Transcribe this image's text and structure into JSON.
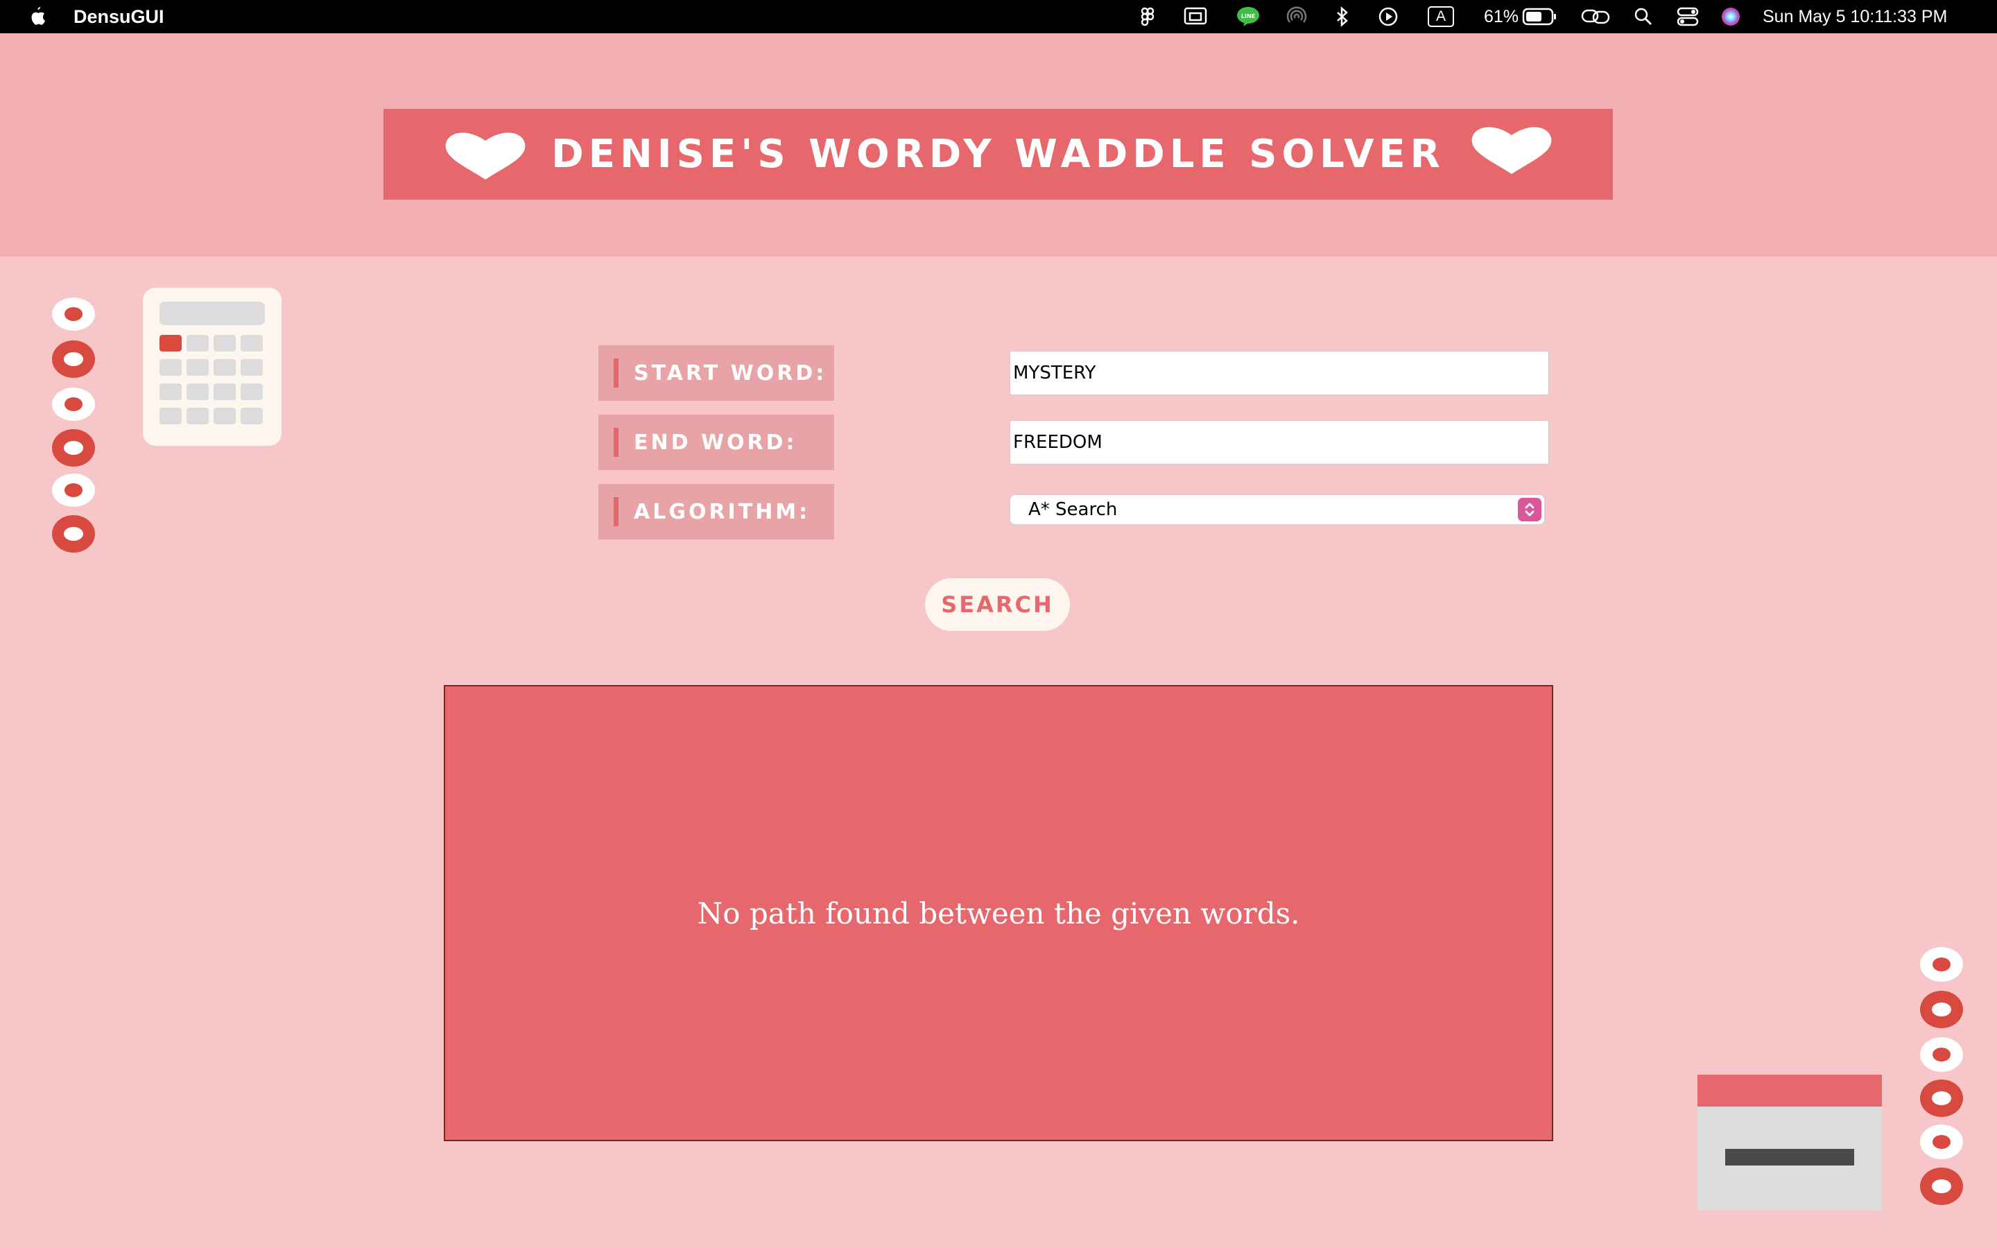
{
  "menubar": {
    "app_name": "DensuGUI",
    "battery": "61%",
    "datetime": "Sun May 5  10:11:33 PM",
    "icons": [
      "apple-icon",
      "figma-icon",
      "screen-mirror-icon",
      "line-icon",
      "airdrop-icon",
      "bluetooth-icon",
      "play-icon",
      "keyboard-input-icon",
      "battery-icon",
      "link-icon",
      "search-icon",
      "control-center-icon",
      "siri-icon"
    ],
    "input_source": "A"
  },
  "app": {
    "title": "DENISE'S WORDY WADDLE SOLVER",
    "form": {
      "start_label": "START WORD:",
      "end_label": "END WORD:",
      "algorithm_label": "ALGORITHM:",
      "start_value": "MYSTERY",
      "end_value": "FREEDOM",
      "algorithm_value": "A* Search"
    },
    "search_button": "SEARCH",
    "result": "No path found between the given words."
  },
  "colors": {
    "background": "#f6c6c8",
    "header_band": "#f2aeb0",
    "accent": "#e6686d",
    "ring_red": "#d84a3f",
    "cream": "#fdf6ee"
  }
}
